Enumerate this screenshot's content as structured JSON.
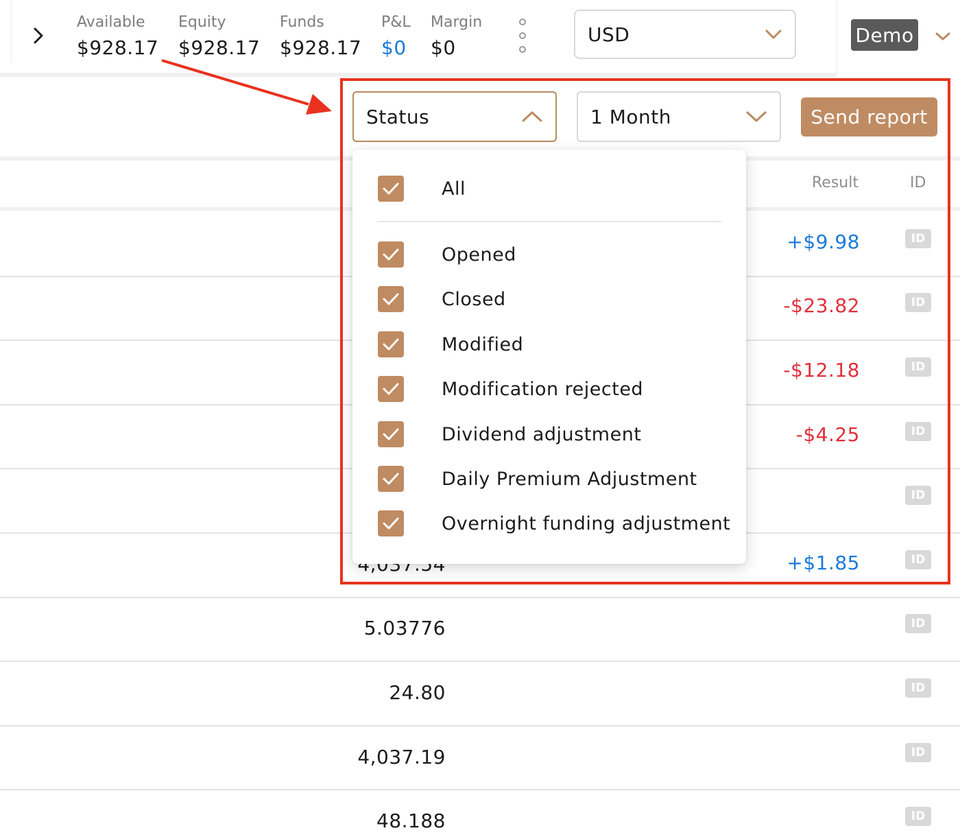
{
  "topbar": {
    "stats": [
      {
        "label": "Available",
        "value": "$928.17"
      },
      {
        "label": "Equity",
        "value": "$928.17"
      },
      {
        "label": "Funds",
        "value": "$928.17"
      },
      {
        "label": "P&L",
        "value": "$0"
      },
      {
        "label": "Margin",
        "value": "$0"
      }
    ],
    "currency": "USD",
    "account_badge": "Demo"
  },
  "filters": {
    "status_label": "Status",
    "period_label": "1 Month",
    "send_report_label": "Send report"
  },
  "status_dropdown": {
    "all_label": "All",
    "all_checked": true,
    "options": [
      {
        "label": "Opened",
        "checked": true
      },
      {
        "label": "Closed",
        "checked": true
      },
      {
        "label": "Modified",
        "checked": true
      },
      {
        "label": "Modification rejected",
        "checked": true
      },
      {
        "label": "Dividend adjustment",
        "checked": true
      },
      {
        "label": "Daily Premium Adjustment",
        "checked": true
      },
      {
        "label": "Overnight funding adjustment",
        "checked": true
      }
    ]
  },
  "table": {
    "columns": {
      "result": "Result",
      "id": "ID"
    },
    "id_badge": "ID",
    "rows": [
      {
        "value": "",
        "result": "+$9.98"
      },
      {
        "value": "",
        "result": "-$23.82"
      },
      {
        "value": "",
        "result": "-$12.18"
      },
      {
        "value": "",
        "result": "-$4.25"
      },
      {
        "value": "",
        "result": ""
      },
      {
        "value": "4,037.54",
        "result": "+$1.85"
      },
      {
        "value": "5.03776",
        "result": ""
      },
      {
        "value": "24.80",
        "result": ""
      },
      {
        "value": "4,037.19",
        "result": ""
      },
      {
        "value": "48.188",
        "result": ""
      }
    ]
  },
  "colors": {
    "accent": "#bf8b62",
    "positive": "#1a7ad9",
    "negative": "#e0303a",
    "annotation": "#e8321e"
  }
}
